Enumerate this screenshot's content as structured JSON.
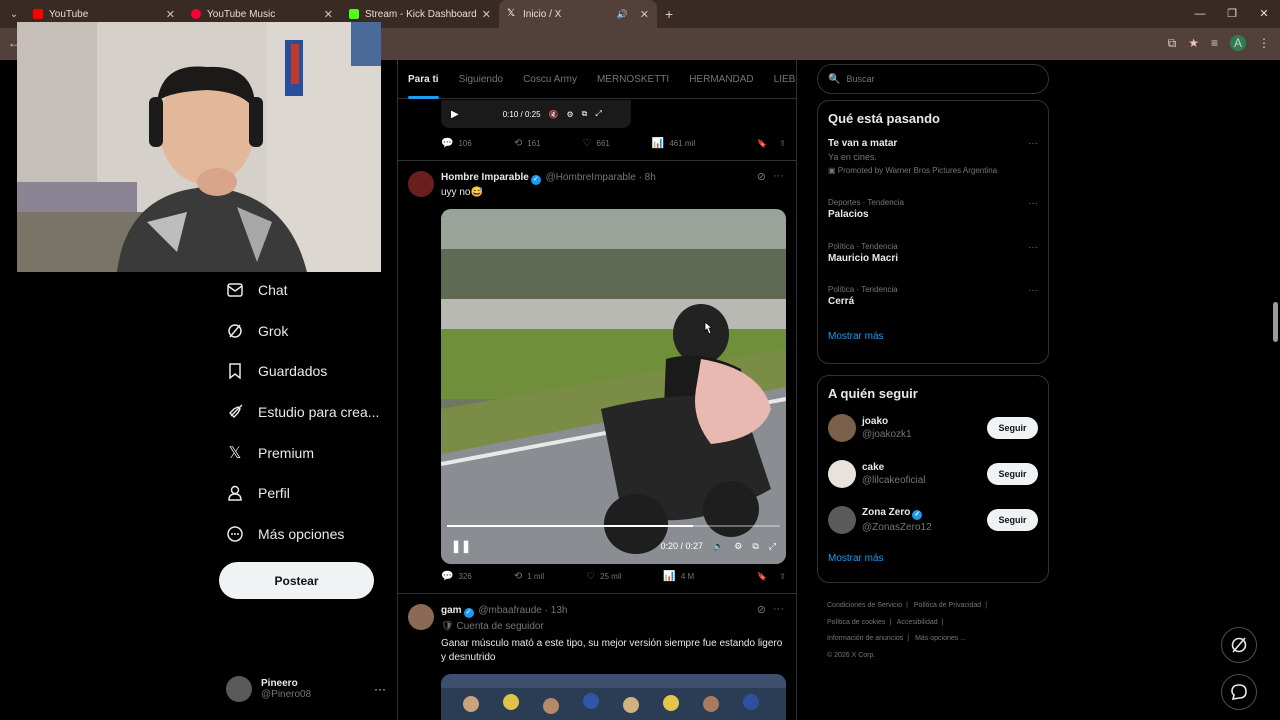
{
  "browser": {
    "tabs": [
      {
        "label": "YouTube",
        "color": "#ff0000"
      },
      {
        "label": "YouTube Music",
        "color": "#ff0033"
      },
      {
        "label": "Stream - Kick Dashboard",
        "color": "#53fc18"
      },
      {
        "label": "Inicio / X",
        "color": "#ffffff"
      }
    ],
    "avatar_letter": "A"
  },
  "leftnav": {
    "items": [
      {
        "label": "Chat",
        "icon": "envelope-icon"
      },
      {
        "label": "Grok",
        "icon": "grok-icon"
      },
      {
        "label": "Guardados",
        "icon": "bookmark-icon"
      },
      {
        "label": "Estudio para crea...",
        "icon": "rocket-icon"
      },
      {
        "label": "Premium",
        "icon": "x-logo-icon"
      },
      {
        "label": "Perfil",
        "icon": "person-icon"
      },
      {
        "label": "Más opciones",
        "icon": "more-circle-icon"
      }
    ],
    "post_button": "Postear",
    "account": {
      "name": "Pineero",
      "handle": "@Pinero08"
    }
  },
  "timeline": {
    "tabs": [
      "Para ti",
      "Siguiendo",
      "Coscu Army",
      "MERNOSKETTI",
      "HERMANDAD",
      "LIEBI"
    ],
    "top_video": {
      "time": "0:10 / 0:25"
    },
    "top_actions": {
      "replies": "106",
      "reposts": "161",
      "likes": "661",
      "views": "461 mil"
    },
    "post1": {
      "name": "Hombre Imparable",
      "handle": "@HombreImparable",
      "time": "· 8h",
      "text": "uyy no😅",
      "video_time": "0:20 / 0:27",
      "video_progress": 0.74,
      "actions": {
        "replies": "326",
        "reposts": "1 mil",
        "likes": "25 mil",
        "views": "4 M"
      }
    },
    "post2": {
      "name": "gam",
      "handle": "@mbaafraude",
      "time": "· 13h",
      "badge": "Cuenta de seguidor",
      "text": "Ganar músculo mató a este tipo, su mejor versión siempre fue estando ligero y desnutrido"
    }
  },
  "right": {
    "search_placeholder": "Buscar",
    "trends_title": "Qué está pasando",
    "trends": [
      {
        "context": "",
        "title": "Te van a matar",
        "sub": "Ya en cines.",
        "promo": "Promoted by Warner Bros Pictures Argentina"
      },
      {
        "context": "Deportes · Tendencia",
        "title": "Palacios"
      },
      {
        "context": "Política · Tendencia",
        "title": "Mauricio Macri"
      },
      {
        "context": "Política · Tendencia",
        "title": "Cerrá"
      }
    ],
    "show_more": "Mostrar más",
    "follow_title": "A quién seguir",
    "follow": [
      {
        "name": "joako",
        "handle": "@joakozk1",
        "verified": false
      },
      {
        "name": "cake",
        "handle": "@lilcakeoficial",
        "verified": false
      },
      {
        "name": "Zona Zero",
        "handle": "@ZonasZero12",
        "verified": true
      }
    ],
    "follow_button": "Seguir",
    "footer": [
      "Condiciones de Servicio",
      "|",
      "Política de Privacidad",
      "|",
      "Política de cookies",
      "|",
      "Accesibilidad",
      "|",
      "Información de anuncios",
      "|",
      "Más opciones ...",
      "© 2026 X Corp."
    ]
  }
}
